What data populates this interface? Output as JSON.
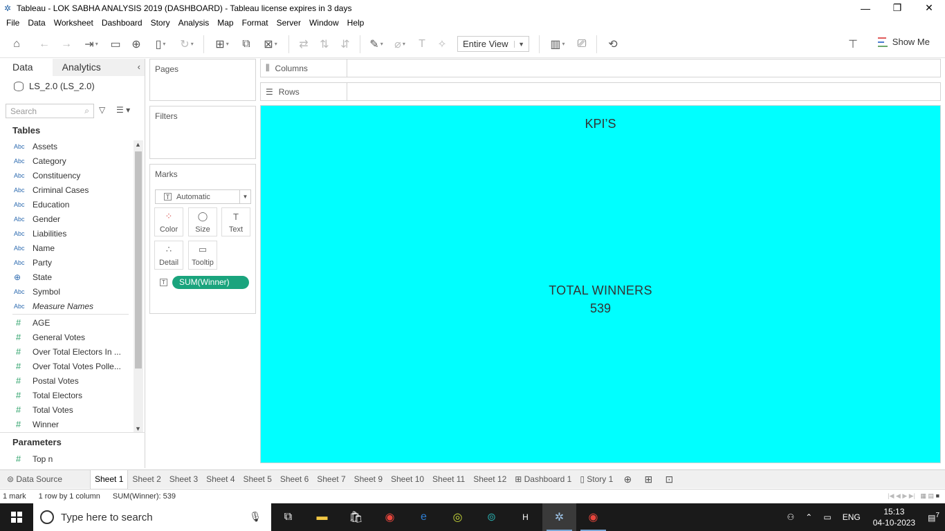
{
  "window": {
    "title": "Tableau - LOK SABHA ANALYSIS 2019 (DASHBOARD) - Tableau license expires in 3 days",
    "minimize": "—",
    "maximize": "❐",
    "close": "✕"
  },
  "menu": [
    "File",
    "Data",
    "Worksheet",
    "Dashboard",
    "Story",
    "Analysis",
    "Map",
    "Format",
    "Server",
    "Window",
    "Help"
  ],
  "toolbar": {
    "view_mode": "Entire View",
    "show_me": "Show Me"
  },
  "data_pane": {
    "tabs": [
      "Data",
      "Analytics"
    ],
    "data_source": "LS_2.0 (LS_2.0)",
    "search_placeholder": "Search",
    "tables_header": "Tables",
    "dimensions": [
      {
        "name": "Assets",
        "type": "Abc"
      },
      {
        "name": "Category",
        "type": "Abc"
      },
      {
        "name": "Constituency",
        "type": "Abc"
      },
      {
        "name": "Criminal Cases",
        "type": "Abc"
      },
      {
        "name": "Education",
        "type": "Abc"
      },
      {
        "name": "Gender",
        "type": "Abc"
      },
      {
        "name": "Liabilities",
        "type": "Abc"
      },
      {
        "name": "Name",
        "type": "Abc"
      },
      {
        "name": "Party",
        "type": "Abc"
      },
      {
        "name": "State",
        "type": "geo"
      },
      {
        "name": "Symbol",
        "type": "Abc"
      },
      {
        "name": "Measure Names",
        "type": "Abc"
      }
    ],
    "measures": [
      {
        "name": "AGE",
        "type": "#"
      },
      {
        "name": "General Votes",
        "type": "#"
      },
      {
        "name": "Over Total Electors  In ...",
        "type": "#"
      },
      {
        "name": "Over Total Votes Polle...",
        "type": "#"
      },
      {
        "name": "Postal Votes",
        "type": "#"
      },
      {
        "name": "Total Electors",
        "type": "#"
      },
      {
        "name": "Total Votes",
        "type": "#"
      },
      {
        "name": "Winner",
        "type": "#"
      }
    ],
    "parameters_header": "Parameters",
    "parameters": [
      {
        "name": "Top n",
        "type": "#"
      }
    ]
  },
  "cards": {
    "pages": "Pages",
    "filters": "Filters",
    "marks": "Marks",
    "mark_type": "Automatic",
    "mark_buttons": [
      "Color",
      "Size",
      "Text",
      "Detail",
      "Tooltip"
    ],
    "pill": "SUM(Winner)"
  },
  "shelves": {
    "columns": "Columns",
    "rows": "Rows"
  },
  "canvas": {
    "background": "#00ffff",
    "title": "KPI’S",
    "kpi_label": "TOTAL WINNERS",
    "kpi_value": "539"
  },
  "sheet_tabs": {
    "data_source": "Data Source",
    "tabs": [
      "Sheet 1",
      "Sheet 2",
      "Sheet 3",
      "Sheet 4",
      "Sheet 5",
      "Sheet 6",
      "Sheet 7",
      "Sheet 9",
      "Sheet 10",
      "Sheet 11",
      "Sheet 12"
    ],
    "dashboard": "Dashboard 1",
    "story": "Story 1",
    "active": "Sheet 1"
  },
  "status_bar": {
    "marks": "1 mark",
    "dimensions": "1 row by 1 column",
    "sum": "SUM(Winner): 539"
  },
  "taskbar": {
    "search_placeholder": "Type here to search",
    "language": "ENG",
    "time": "15:13",
    "date": "04-10-2023",
    "notification_count": "7"
  },
  "colors": {
    "pill": "#1aa47d",
    "canvas": "#00ffff",
    "measure_icon": "#2fa36b",
    "dimension_icon": "#2d6bb0"
  }
}
